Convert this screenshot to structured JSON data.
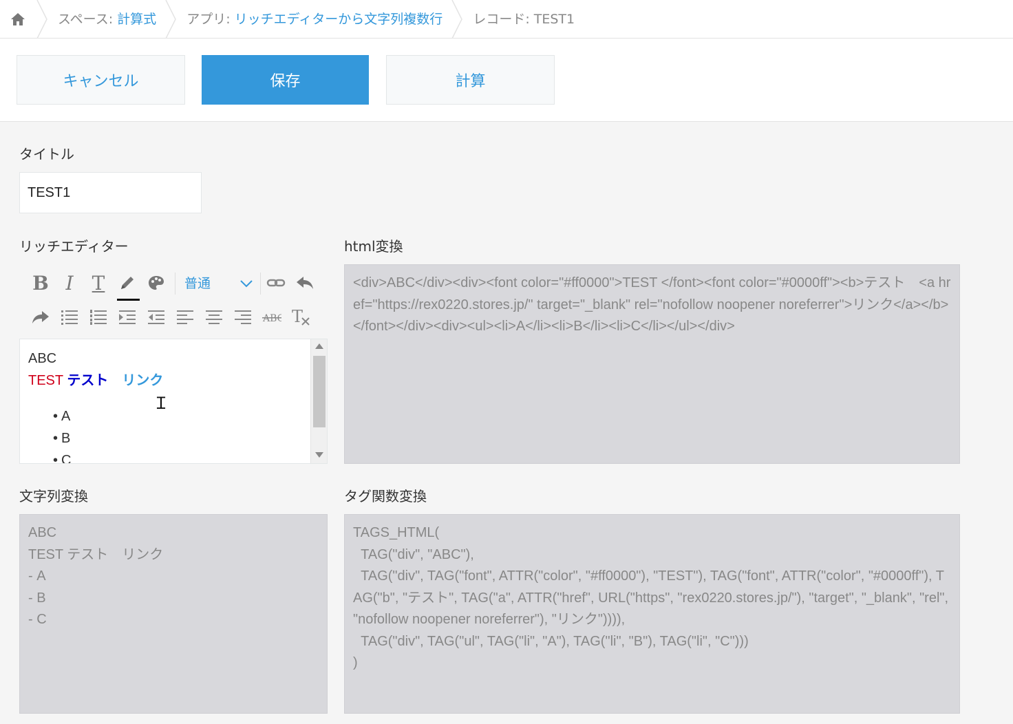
{
  "breadcrumb": {
    "space_prefix": "スペース: ",
    "space_name": "計算式",
    "app_prefix": "アプリ: ",
    "app_name": "リッチエディターから文字列複数行",
    "record_prefix": "レコード: ",
    "record_name": "TEST1"
  },
  "toolbar": {
    "cancel_label": "キャンセル",
    "save_label": "保存",
    "calc_label": "計算"
  },
  "fields": {
    "title_label": "タイトル",
    "title_value": "TEST1",
    "rich_label": "リッチエディター",
    "html_label": "html変換",
    "string_label": "文字列変換",
    "tag_label": "タグ関数変換"
  },
  "rich_editor": {
    "font_size": "普通",
    "line1": "ABC",
    "red_text": "TEST",
    "blue_text": "テスト",
    "link_text": "リンク",
    "items": [
      "A",
      "B",
      "C"
    ]
  },
  "html_value": "<div>ABC</div><div><font color=\"#ff0000\">TEST </font><font color=\"#0000ff\"><b>テスト　<a href=\"https://rex0220.stores.jp/\" target=\"_blank\" rel=\"nofollow noopener noreferrer\">リンク</a></b></font></div><div><ul><li>A</li><li>B</li><li>C</li></ul></div>",
  "string_value": "ABC\nTEST テスト　リンク\n- A\n- B\n- C",
  "tag_value": "TAGS_HTML(\n  TAG(\"div\", \"ABC\"),\n  TAG(\"div\", TAG(\"font\", ATTR(\"color\", \"#ff0000\"), \"TEST\"), TAG(\"font\", ATTR(\"color\", \"#0000ff\"), TAG(\"b\", \"テスト\", TAG(\"a\", ATTR(\"href\", URL(\"https\", \"rex0220.stores.jp/\"), \"target\", \"_blank\", \"rel\", \"nofollow noopener noreferrer\"), \"リンク\")))),\n  TAG(\"div\", TAG(\"ul\", TAG(\"li\", \"A\"), TAG(\"li\", \"B\"), TAG(\"li\", \"C\")))\n)",
  "colors": {
    "accent": "#3498db",
    "red_text": "#d0021b",
    "blue_text": "#0000cc",
    "readonly_bg": "#d8d8dc"
  },
  "icons": [
    "home-icon",
    "bold-icon",
    "italic-icon",
    "text-size-icon",
    "font-color-icon",
    "background-color-icon",
    "link-icon",
    "undo-icon",
    "redo-icon",
    "bullet-list-icon",
    "numbered-list-icon",
    "indent-icon",
    "outdent-icon",
    "align-left-icon",
    "align-center-icon",
    "align-right-icon",
    "strikethrough-icon",
    "clear-format-icon"
  ]
}
